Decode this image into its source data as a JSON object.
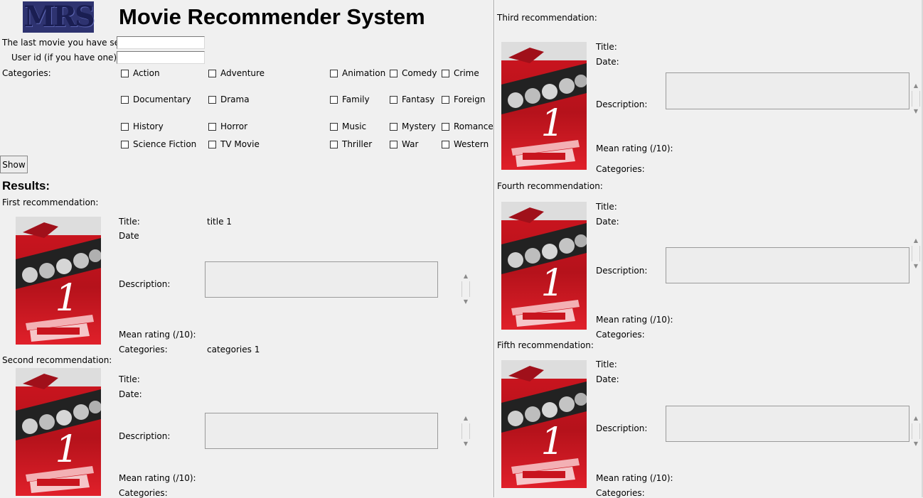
{
  "header": {
    "logo_text": "MRS",
    "title": "Movie Recommender System"
  },
  "form": {
    "last_movie_label": "The last movie you have seen:",
    "last_movie_value": "",
    "user_id_label": "User id (if you have one):",
    "user_id_value": "",
    "categories_label": "Categories:",
    "categories": [
      {
        "label": "Action",
        "checked": false
      },
      {
        "label": "Adventure",
        "checked": false
      },
      {
        "label": "Animation",
        "checked": false
      },
      {
        "label": "Comedy",
        "checked": false
      },
      {
        "label": "Crime",
        "checked": false
      },
      {
        "label": "Documentary",
        "checked": false
      },
      {
        "label": "Drama",
        "checked": false
      },
      {
        "label": "Family",
        "checked": false
      },
      {
        "label": "Fantasy",
        "checked": false
      },
      {
        "label": "Foreign",
        "checked": false
      },
      {
        "label": "History",
        "checked": false
      },
      {
        "label": "Horror",
        "checked": false
      },
      {
        "label": "Music",
        "checked": false
      },
      {
        "label": "Mystery",
        "checked": false
      },
      {
        "label": "Romance",
        "checked": false
      },
      {
        "label": "Science Fiction",
        "checked": false
      },
      {
        "label": "TV Movie",
        "checked": false
      },
      {
        "label": "Thriller",
        "checked": false
      },
      {
        "label": "War",
        "checked": false
      },
      {
        "label": "Western",
        "checked": false
      }
    ],
    "show_button": "Show"
  },
  "results": {
    "heading": "Results:",
    "field_labels": {
      "title": "Title:",
      "date_first": "Date",
      "date": "Date:",
      "description": "Description:",
      "mean_rating": "Mean rating (/10):",
      "categories": "Categories:"
    },
    "recommendations": [
      {
        "heading": "First recommendation:",
        "title": "title 1",
        "date": "",
        "description": "",
        "mean_rating": "",
        "categories": "categories 1"
      },
      {
        "heading": "Second recommendation:",
        "title": "",
        "date": "",
        "description": "",
        "mean_rating": "",
        "categories": ""
      },
      {
        "heading": "Third recommendation:",
        "title": "",
        "date": "",
        "description": "",
        "mean_rating": "",
        "categories": ""
      },
      {
        "heading": "Fourth recommendation:",
        "title": "",
        "date": "",
        "description": "",
        "mean_rating": "",
        "categories": ""
      },
      {
        "heading": "Fifth recommendation:",
        "title": "",
        "date": "",
        "description": "",
        "mean_rating": "",
        "categories": ""
      }
    ]
  },
  "colors": {
    "background": "#f0f0f0",
    "logo_bg": "#2e3370",
    "poster_red": "#c8141e"
  }
}
